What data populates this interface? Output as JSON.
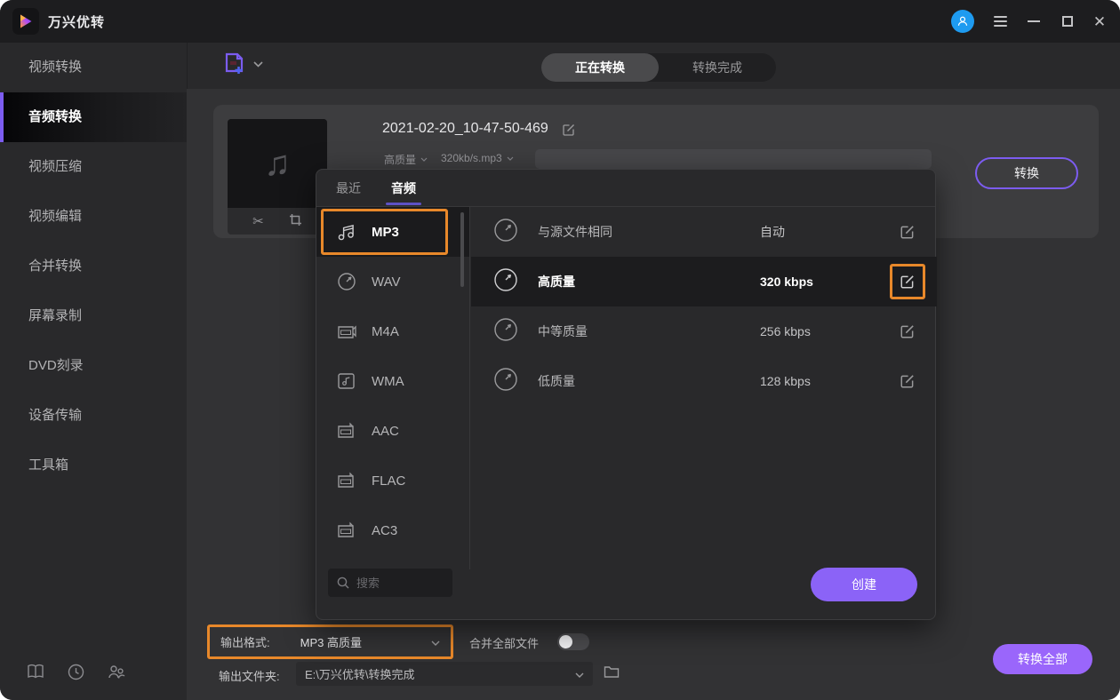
{
  "titlebar": {
    "title": "万兴优转"
  },
  "sidebar": {
    "items": [
      {
        "label": "视频转换",
        "active": false
      },
      {
        "label": "音频转换",
        "active": true
      },
      {
        "label": "视频压缩",
        "active": false
      },
      {
        "label": "视频编辑",
        "active": false
      },
      {
        "label": "合并转换",
        "active": false
      },
      {
        "label": "屏幕录制",
        "active": false
      },
      {
        "label": "DVD刻录",
        "active": false
      },
      {
        "label": "设备传输",
        "active": false
      },
      {
        "label": "工具箱",
        "active": false
      }
    ]
  },
  "tabs": {
    "converting": "正在转换",
    "finished": "转换完成"
  },
  "task": {
    "filename": "2021-02-20_10-47-50-469",
    "quality_label": "高质量",
    "format_info": "320kb/s.mp3",
    "convert_button": "转换"
  },
  "format_panel": {
    "tab_recent": "最近",
    "tab_audio": "音频",
    "formats": [
      {
        "name": "MP3",
        "selected": true
      },
      {
        "name": "WAV",
        "selected": false
      },
      {
        "name": "M4A",
        "selected": false
      },
      {
        "name": "WMA",
        "selected": false
      },
      {
        "name": "AAC",
        "selected": false
      },
      {
        "name": "FLAC",
        "selected": false
      },
      {
        "name": "AC3",
        "selected": false
      }
    ],
    "qualities": [
      {
        "label": "与源文件相同",
        "value": "自动",
        "highlighted": false
      },
      {
        "label": "高质量",
        "value": "320 kbps",
        "highlighted": true
      },
      {
        "label": "中等质量",
        "value": "256 kbps",
        "highlighted": false
      },
      {
        "label": "低质量",
        "value": "128 kbps",
        "highlighted": false
      }
    ],
    "search_placeholder": "搜索",
    "create_button": "创建"
  },
  "footer": {
    "output_format_label": "输出格式:",
    "output_format_value": "MP3 高质量",
    "merge_label": "合并全部文件",
    "merge_on": false,
    "output_folder_label": "输出文件夹:",
    "output_folder_value": "E:\\万兴优转\\转换完成",
    "convert_all_button": "转换全部"
  },
  "icons": {
    "thumb_note": "♫",
    "scissors": "✂"
  },
  "colors": {
    "accent_purple": "#8b63f7",
    "accent_orange": "#e8882a",
    "avatar_blue": "#1e9bf0",
    "tab_underline": "#5d51c5"
  }
}
